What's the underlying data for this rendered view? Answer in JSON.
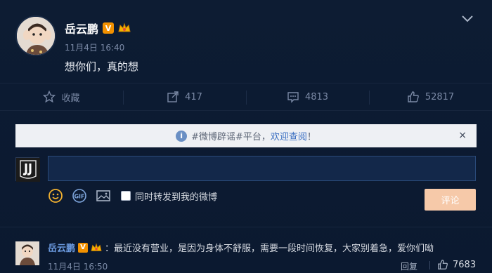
{
  "post": {
    "author": "岳云鹏",
    "verified_badge": "V",
    "time": "11月4日 16:40",
    "text": "想你们，真的想"
  },
  "actions": {
    "favorite_label": "收藏",
    "repost_count": "417",
    "comment_count": "4813",
    "like_count": "52817"
  },
  "notice": {
    "prefix": "#微博辟谣#平台，",
    "link": "欢迎查阅",
    "suffix": "！",
    "close": "×"
  },
  "compose": {
    "input_value": "",
    "repost_label": "同时转发到我的微博",
    "submit_label": "评论"
  },
  "comment": {
    "author": "岳云鹏",
    "verified_badge": "V",
    "text": "：最近没有营业，是因为身体不舒服，需要一段时间恢复，大家别着急，爱你们呦",
    "time": "11月4日 16:50",
    "reply_label": "回复",
    "like_count": "7683"
  },
  "colors": {
    "background": "#0c1a30",
    "accent_orange": "#f29100",
    "link_blue": "#3b6fc2",
    "button_disabled": "#f6c9a9"
  }
}
